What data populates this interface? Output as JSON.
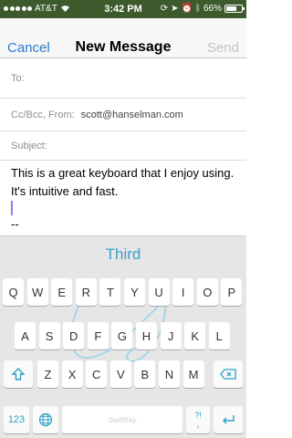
{
  "status": {
    "carrier": "AT&T",
    "time": "3:42 PM",
    "battery": "66%",
    "battery_level": 0.66
  },
  "nav": {
    "cancel": "Cancel",
    "title": "New Message",
    "send": "Send"
  },
  "form": {
    "to_label": "To:",
    "ccbcc_label": "Cc/Bcc, From:",
    "from_value": "scott@hanselman.com",
    "subject_label": "Subject:",
    "body_line1": "This is a great keyboard that I enjoy using.",
    "body_line2": "It's intuitive and fast.",
    "signature": "--"
  },
  "keyboard": {
    "prediction": "Third",
    "row1": [
      "Q",
      "W",
      "E",
      "R",
      "T",
      "Y",
      "U",
      "I",
      "O",
      "P"
    ],
    "row2": [
      "A",
      "S",
      "D",
      "F",
      "G",
      "H",
      "J",
      "K",
      "L"
    ],
    "row3": [
      "Z",
      "X",
      "C",
      "V",
      "B",
      "N",
      "M"
    ],
    "numbers_key": "123",
    "punct_key_top": "?!",
    "punct_key_bottom": ",",
    "space_logo": "SwiftKey",
    "accent": "#2aa1c7"
  }
}
